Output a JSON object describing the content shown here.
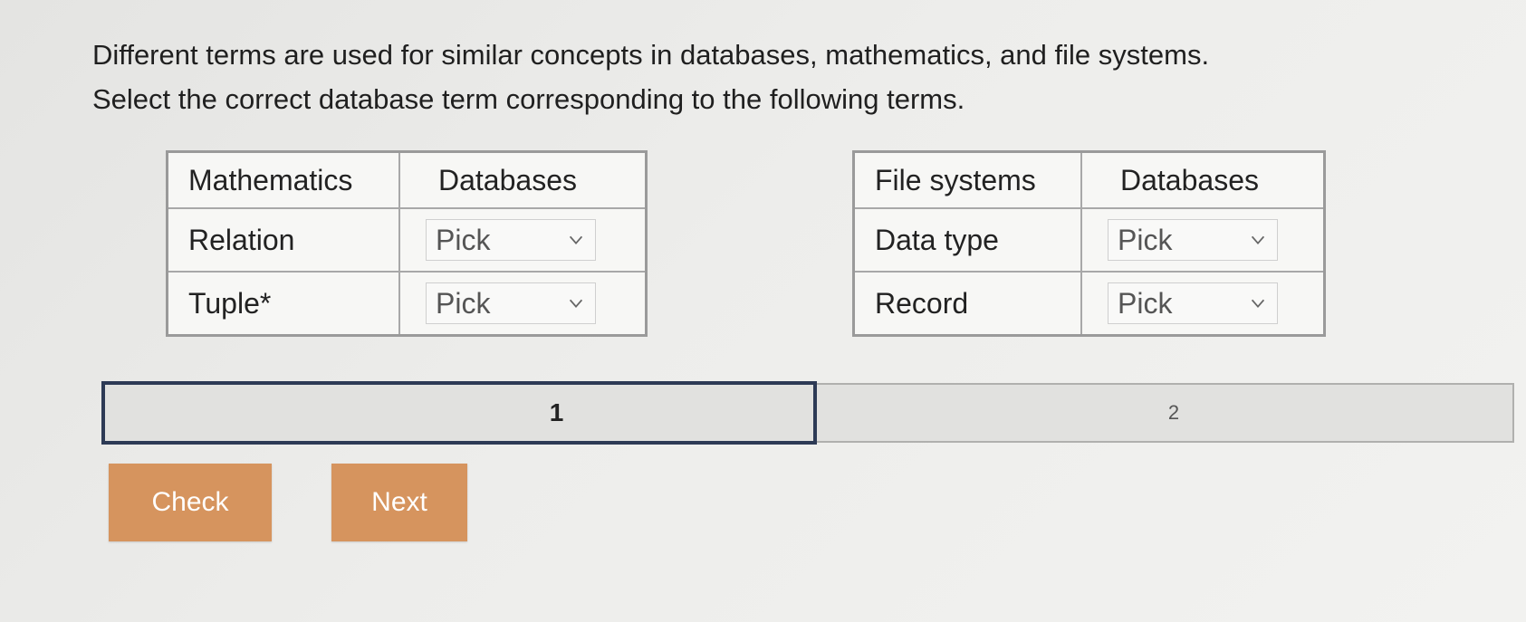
{
  "prompt": {
    "line1": "Different terms are used for similar concepts in databases, mathematics, and file systems.",
    "line2": "Select the correct database term corresponding to the following terms."
  },
  "table_math": {
    "headers": [
      "Mathematics",
      "Databases"
    ],
    "rows": [
      {
        "term": "Relation",
        "select": "Pick"
      },
      {
        "term": "Tuple*",
        "select": "Pick"
      }
    ]
  },
  "table_fs": {
    "headers": [
      "File systems",
      "Databases"
    ],
    "rows": [
      {
        "term": "Data type",
        "select": "Pick"
      },
      {
        "term": "Record",
        "select": "Pick"
      }
    ]
  },
  "progress": {
    "steps": [
      "1",
      "2"
    ],
    "active_step": 1
  },
  "buttons": {
    "check": "Check",
    "next": "Next"
  },
  "colors": {
    "button_bg": "#d6945e",
    "active_step_border": "#2d3a55"
  },
  "icons": {
    "select_chevron": "chevron-down-icon"
  }
}
